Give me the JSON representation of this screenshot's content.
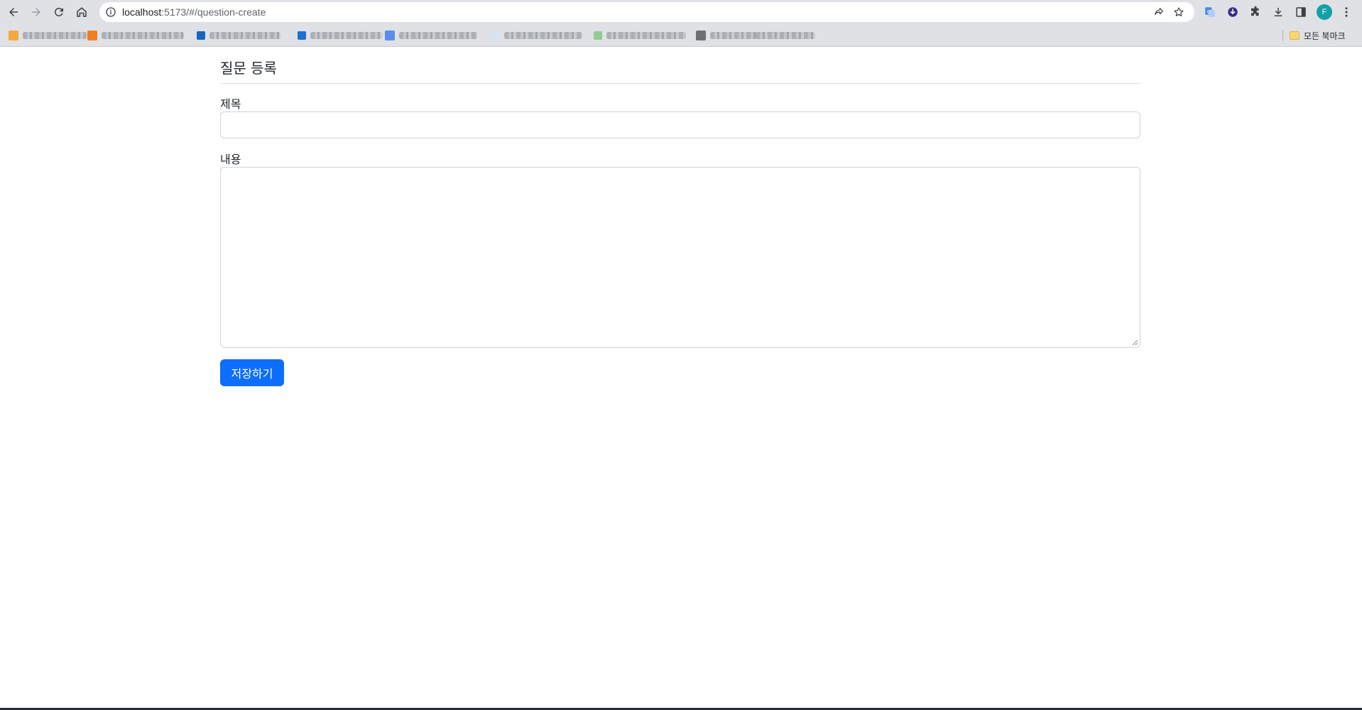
{
  "browser": {
    "url_host": "localhost",
    "url_path": ":5173/#/question-create",
    "profile_initial": "F",
    "all_bookmarks_label": "모든 북마크"
  },
  "page": {
    "title": "질문 등록",
    "subject_label": "제목",
    "subject_value": "",
    "content_label": "내용",
    "content_value": "",
    "save_label": "저장하기"
  },
  "colors": {
    "primary": "#0d6efd",
    "profile": "#12a0a8"
  }
}
